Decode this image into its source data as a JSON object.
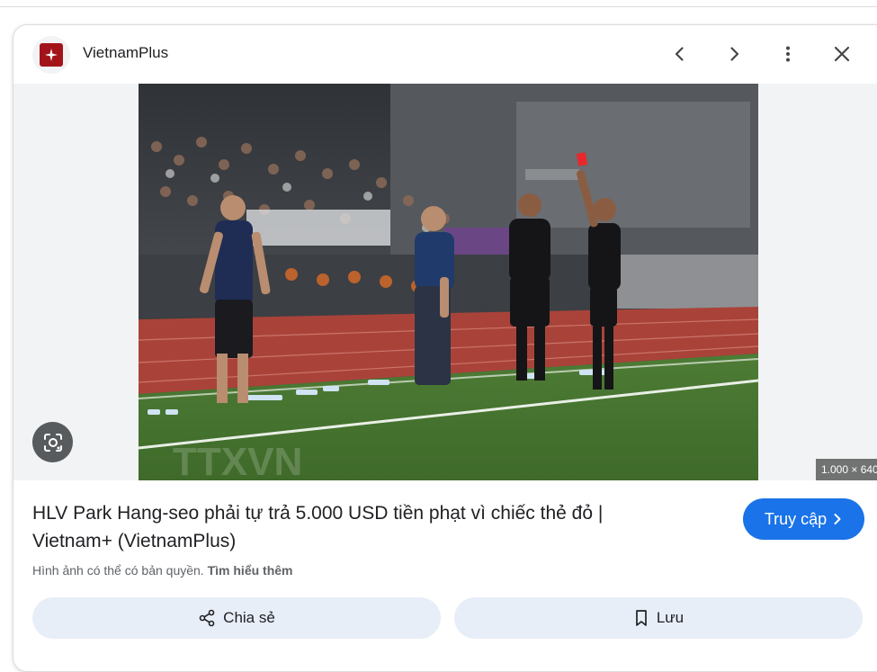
{
  "source": {
    "name": "VietnamPlus"
  },
  "header": {
    "prev_label": "Previous",
    "next_label": "Next",
    "more_label": "More options",
    "close_label": "Close"
  },
  "image": {
    "dimensions": "1.000 × 640",
    "watermark": "TTXVN",
    "lens_label": "Search with Google Lens"
  },
  "result": {
    "title": "HLV Park Hang-seo phải tự trả 5.000 USD tiền phạt vì chiếc thẻ đỏ | Vietnam+ (VietnamPlus)",
    "visit_label": "Truy cập",
    "copyright_text": "Hình ảnh có thể có bản quyền.",
    "learn_more": "Tìm hiểu thêm"
  },
  "actions": {
    "share_label": "Chia sẻ",
    "save_label": "Lưu"
  },
  "colors": {
    "accent": "#1a73e8",
    "action_bg": "#e8eef8",
    "favicon": "#a3141a"
  }
}
